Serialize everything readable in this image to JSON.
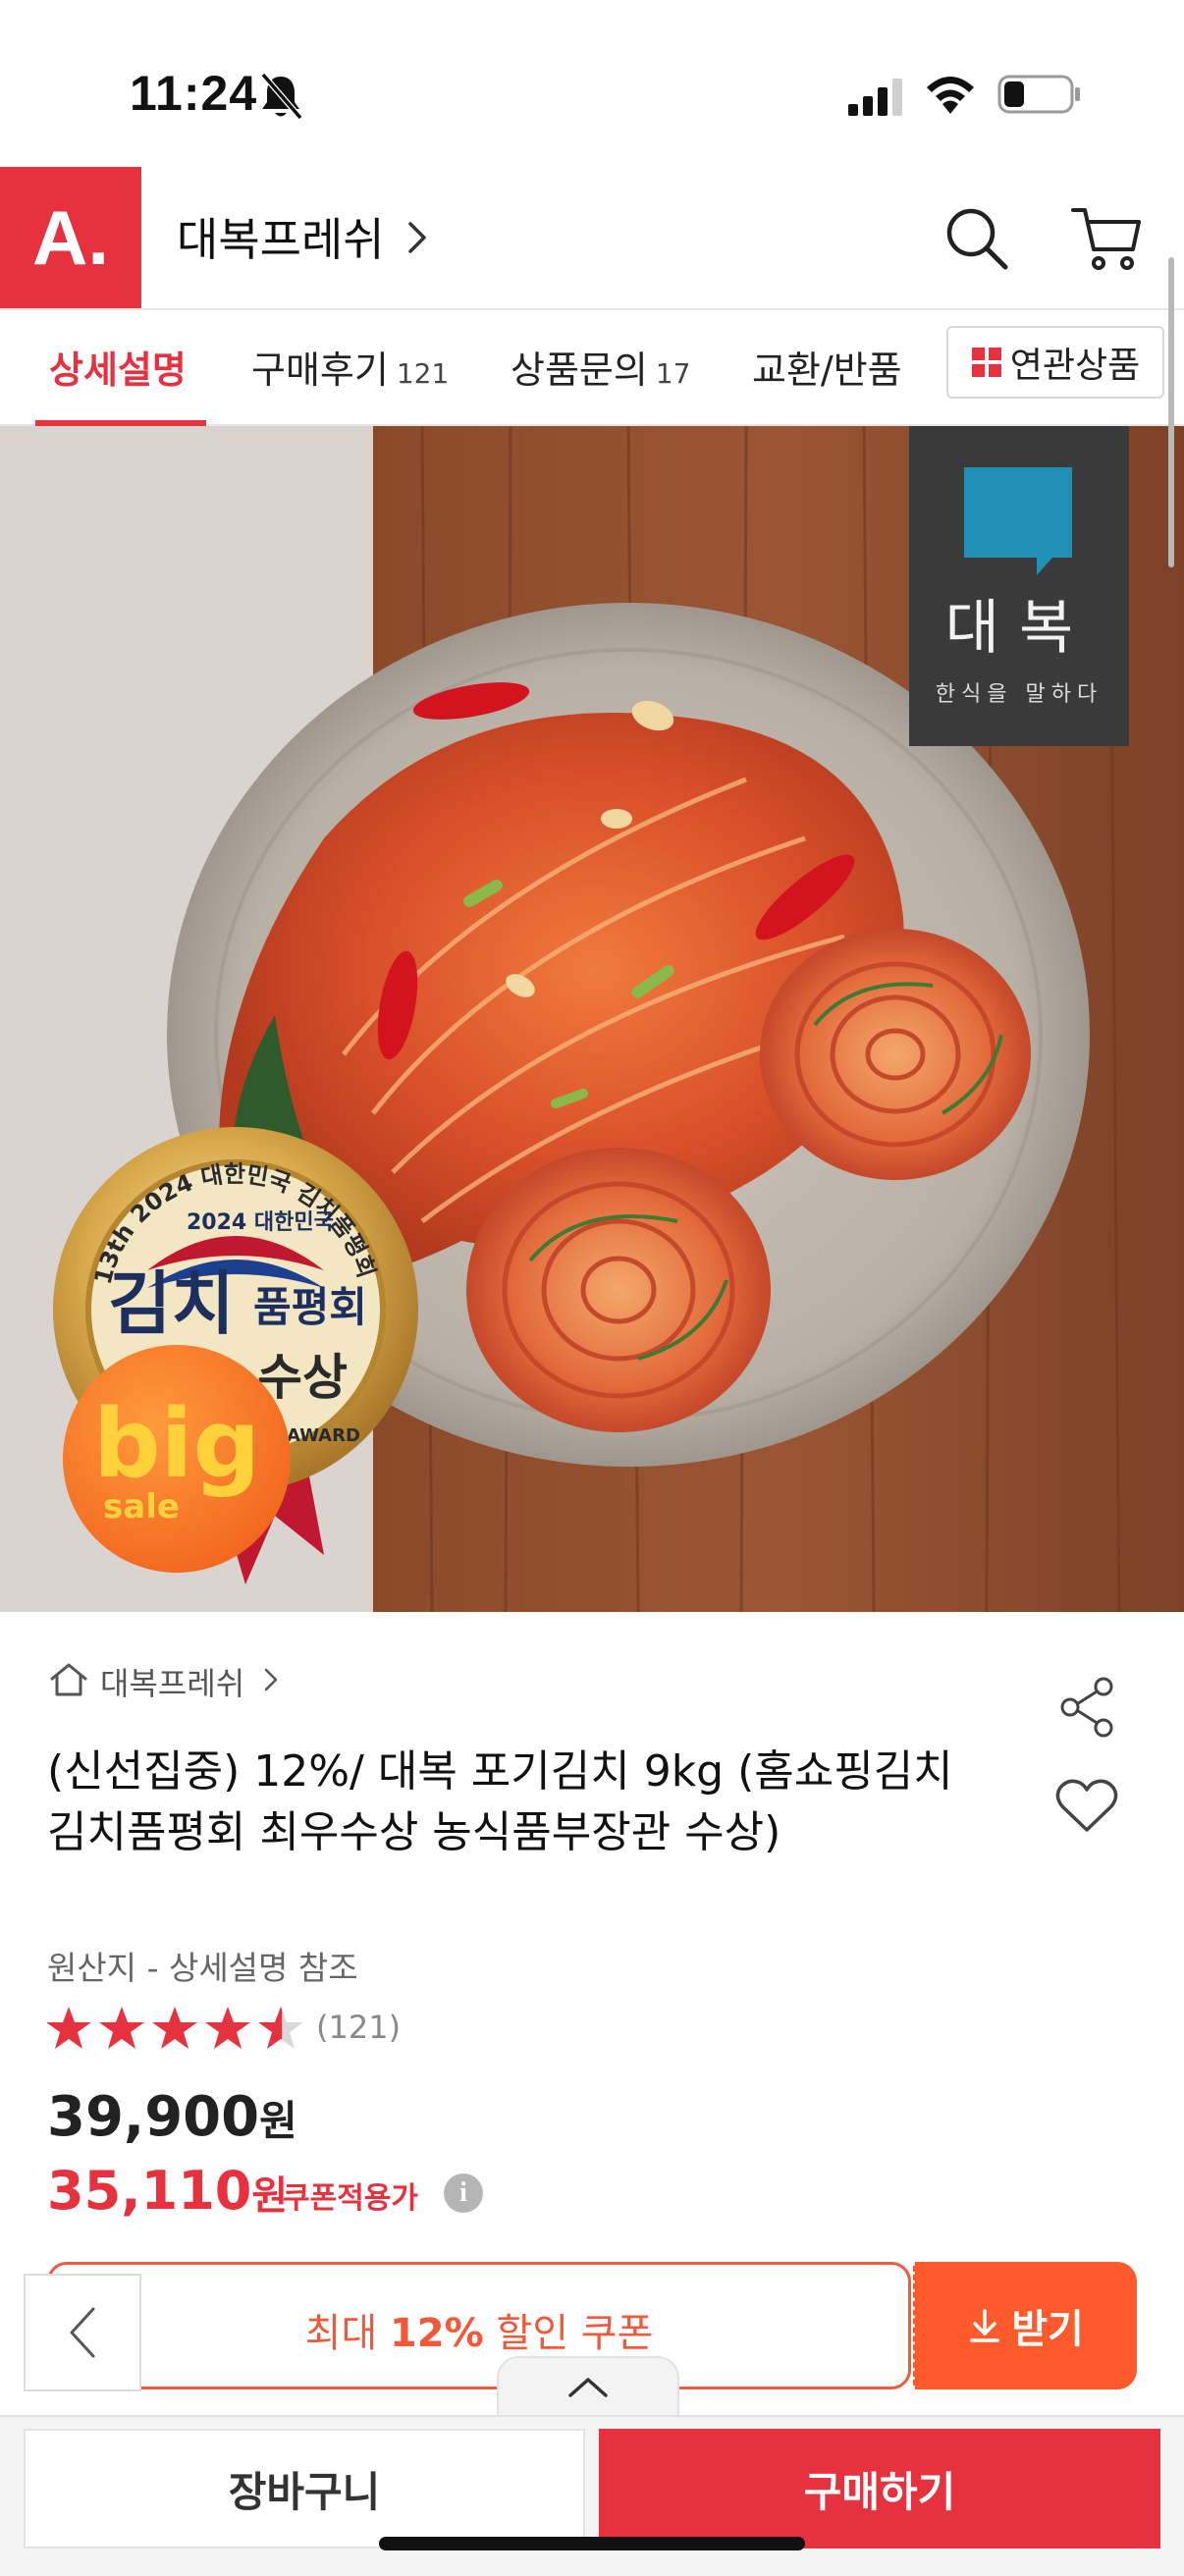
{
  "status_bar": {
    "time": "11:24"
  },
  "header": {
    "logo": "A.",
    "store_name": "대복프레쉬"
  },
  "tabs": [
    {
      "label": "상세설명",
      "count": ""
    },
    {
      "label": "구매후기",
      "count": "121"
    },
    {
      "label": "상품문의",
      "count": "17"
    },
    {
      "label": "교환/반품",
      "count": ""
    },
    {
      "label": "연관상품",
      "count": ""
    }
  ],
  "image": {
    "brand_sign_title": "대복",
    "brand_sign_sub": "한식을 말하다",
    "badge_arc": "13th 2024 대한민국 김치품평회",
    "badge_year": "2024 대한민국",
    "badge_main": "김치",
    "badge_main2": "품평회",
    "badge_award": "수상",
    "badge_bottom": "AWARD",
    "sale_big": "big",
    "sale_small": "sale"
  },
  "product": {
    "brand": "대복프레쉬",
    "title": "(신선집중) 12%/ 대복 포기김치 9kg (홈쇼핑김치 김치품평회 최우수상 농식품부장관 수상)",
    "origin": "원산지 - 상세설명 참조",
    "rating": 4.5,
    "review_count": "(121)",
    "price": "39,900",
    "price_unit": "원",
    "sale_price": "35,110",
    "sale_unit": "원",
    "coupon_applicable": "쿠폰적용가",
    "info": "i"
  },
  "coupon": {
    "prefix": "최대 ",
    "percent": "12%",
    "suffix": " 할인 쿠폰",
    "download_label": "받기"
  },
  "bottom": {
    "cart_label": "장바구니",
    "buy_label": "구매하기"
  },
  "colors": {
    "accent": "#e5323e",
    "coupon": "#ff5a2c"
  }
}
